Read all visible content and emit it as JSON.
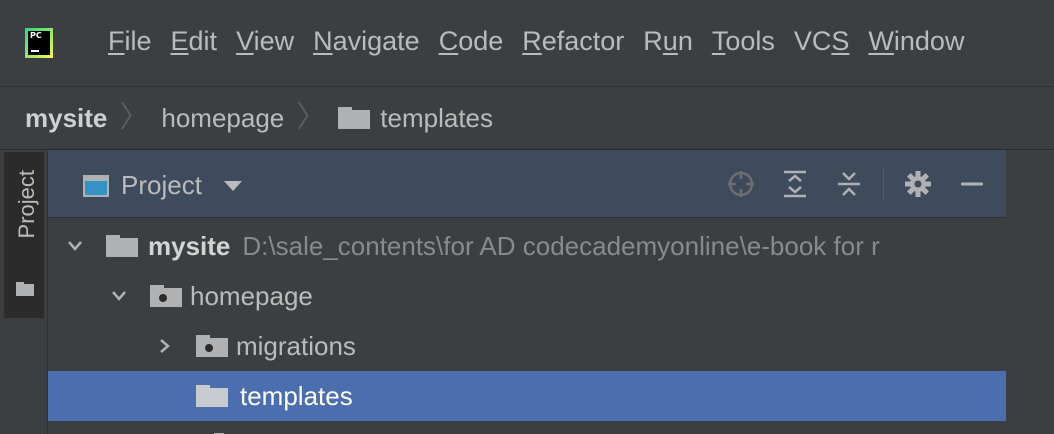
{
  "menu": {
    "app_logo_text": "PC",
    "items": [
      {
        "label_mnemonic": "F",
        "label_rest": "ile"
      },
      {
        "label_mnemonic": "E",
        "label_rest": "dit"
      },
      {
        "label_mnemonic": "V",
        "label_rest": "iew"
      },
      {
        "label_mnemonic": "N",
        "label_rest": "avigate"
      },
      {
        "label_mnemonic": "C",
        "label_rest": "ode"
      },
      {
        "label_mnemonic": "R",
        "label_rest": "efactor"
      },
      {
        "label_pre": "R",
        "label_mnemonic": "u",
        "label_rest": "n"
      },
      {
        "label_mnemonic": "T",
        "label_rest": "ools"
      },
      {
        "label_pre": "VC",
        "label_mnemonic": "S",
        "label_rest": ""
      },
      {
        "label_mnemonic": "W",
        "label_rest": "indow"
      }
    ]
  },
  "breadcrumb": {
    "items": [
      "mysite",
      "homepage",
      "templates"
    ],
    "separator": "〉"
  },
  "tool_strip": {
    "tab_label": "Project"
  },
  "project_panel": {
    "view_label": "Project",
    "tree": [
      {
        "name": "mysite",
        "path": "D:\\sale_contents\\for AD codecademyonline\\e-book for r",
        "expanded": true,
        "bold": true
      },
      {
        "name": "homepage",
        "expanded": true
      },
      {
        "name": "migrations",
        "expanded": false
      },
      {
        "name": "templates",
        "selected": true
      }
    ]
  },
  "colors": {
    "background": "#3c3f41",
    "panel_header": "#3d4b5c",
    "selection": "#4b6eaf",
    "text": "#bbbbbb"
  }
}
